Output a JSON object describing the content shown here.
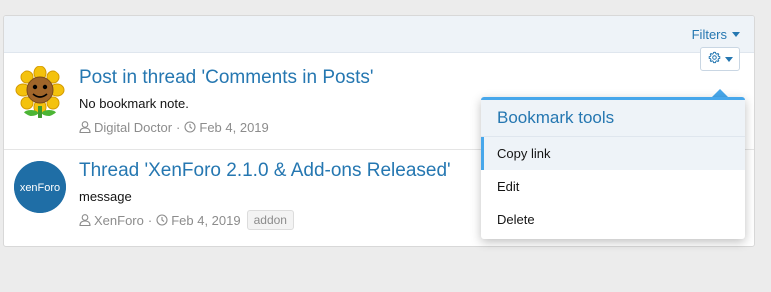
{
  "filter_bar": {
    "filters_label": "Filters"
  },
  "bookmarks": [
    {
      "title": "Post in thread 'Comments in Posts'",
      "note": "No bookmark note.",
      "author": "Digital Doctor",
      "date": "Feb 4, 2019",
      "tag": null
    },
    {
      "title": "Thread 'XenForo 2.1.0 & Add-ons Released'",
      "note": "message",
      "author": "XenForo",
      "date": "Feb 4, 2019",
      "tag": "addon",
      "avatar_text": "xenForo"
    }
  ],
  "menu": {
    "header": "Bookmark tools",
    "items": [
      "Copy link",
      "Edit",
      "Delete"
    ]
  },
  "colors": {
    "accent": "#2577b1",
    "menu_accent": "#47a7eb",
    "header_bg": "#eef3f8",
    "xenforo_avatar_bg": "#1f6ea6"
  },
  "icons": [
    "caret-down-icon",
    "gear-icon",
    "user-icon",
    "clock-icon",
    "sunflower-avatar",
    "xenforo-logo"
  ]
}
